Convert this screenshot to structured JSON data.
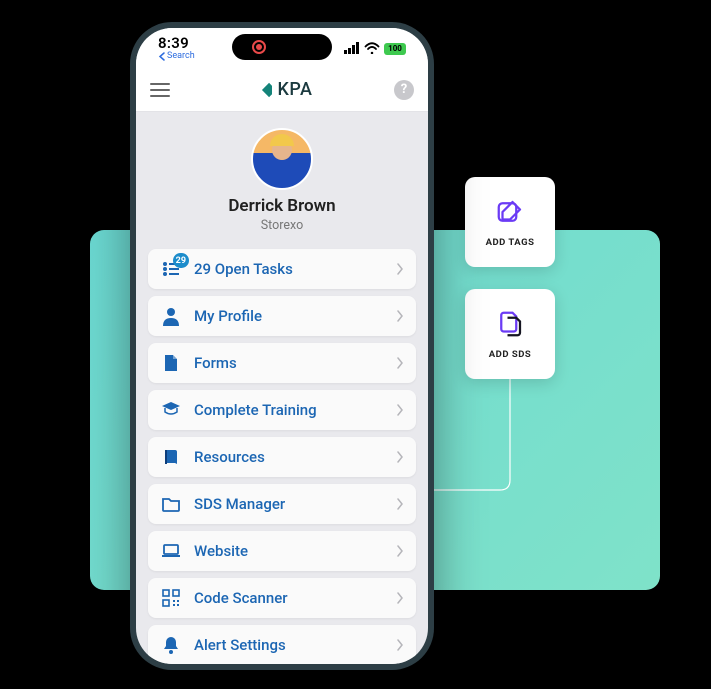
{
  "status": {
    "clock": "8:39",
    "search_back": "Search",
    "battery": "100"
  },
  "header": {
    "brand": "KPA"
  },
  "profile": {
    "name": "Derrick Brown",
    "org": "Storexo"
  },
  "menu": {
    "open_tasks_count": "29",
    "items": [
      {
        "label": "29 Open Tasks",
        "icon": "tasks"
      },
      {
        "label": "My Profile",
        "icon": "user"
      },
      {
        "label": "Forms",
        "icon": "forms"
      },
      {
        "label": "Complete Training",
        "icon": "training"
      },
      {
        "label": "Resources",
        "icon": "resources"
      },
      {
        "label": "SDS Manager",
        "icon": "folder"
      },
      {
        "label": "Website",
        "icon": "laptop"
      },
      {
        "label": "Code Scanner",
        "icon": "qr"
      },
      {
        "label": "Alert Settings",
        "icon": "bell"
      }
    ]
  },
  "side": {
    "add_tags": "ADD TAGS",
    "add_sds": "ADD SDS"
  },
  "colors": {
    "brand_blue": "#1C66B3",
    "icon_purple": "#6B3BF5"
  }
}
